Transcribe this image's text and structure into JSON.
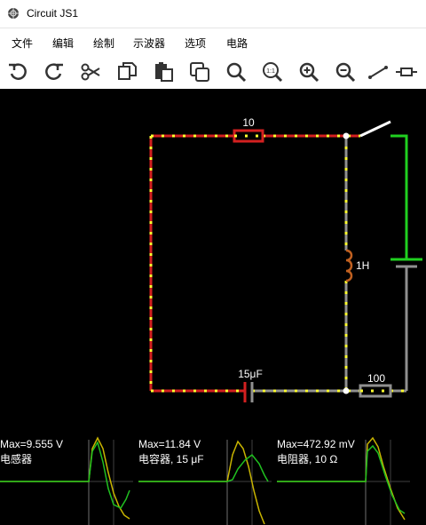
{
  "window": {
    "title": "Circuit JS1"
  },
  "menu": {
    "file": "文件",
    "edit": "编辑",
    "draw": "绘制",
    "scopes": "示波器",
    "options": "选项",
    "circuits": "电路"
  },
  "toolbar": {
    "icons": [
      "undo-icon",
      "redo-icon",
      "cut-icon",
      "copy-icon",
      "paste-icon",
      "duplicate-icon",
      "search-icon",
      "zoom-100-icon",
      "zoom-in-icon",
      "zoom-out-icon",
      "wire-icon",
      "resistor-icon"
    ],
    "zoom_100_label": "1:1"
  },
  "circuit": {
    "resistor_top_label": "10",
    "inductor_label": "1H",
    "capacitor_label": "15μF",
    "resistor_bottom_label": "100",
    "colors": {
      "current": "#ff2020",
      "dots": "#ffff00",
      "wire_neutral": "#808080",
      "positive": "#00ff00"
    }
  },
  "scopes": [
    {
      "max": "Max=9.555 V",
      "name": "电感器"
    },
    {
      "max": "Max=11.84 V",
      "name": "电容器, 15 μF"
    },
    {
      "max": "Max=472.92 mV",
      "name": "电阻器, 10 Ω"
    }
  ]
}
